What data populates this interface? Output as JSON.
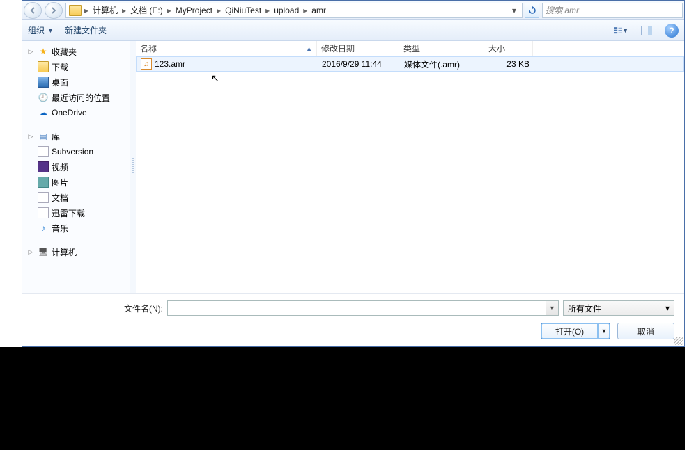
{
  "breadcrumb": {
    "items": [
      "计算机",
      "文档 (E:)",
      "MyProject",
      "QiNiuTest",
      "upload",
      "amr"
    ]
  },
  "search": {
    "placeholder": "搜索 amr"
  },
  "toolbar": {
    "organize": "组织",
    "newfolder": "新建文件夹"
  },
  "sidebar": {
    "favorites": "收藏夹",
    "downloads": "下载",
    "desktop": "桌面",
    "recent": "最近访问的位置",
    "onedrive": "OneDrive",
    "library": "库",
    "subversion": "Subversion",
    "video": "视频",
    "pictures": "图片",
    "documents": "文档",
    "xunlei": "迅雷下载",
    "music": "音乐",
    "computer": "计算机"
  },
  "columns": {
    "name": "名称",
    "modified": "修改日期",
    "type": "类型",
    "size": "大小"
  },
  "files": [
    {
      "name": "123.amr",
      "modified": "2016/9/29 11:44",
      "type": "媒体文件(.amr)",
      "size": "23 KB"
    }
  ],
  "footer": {
    "filename_label": "文件名(N):",
    "filter": "所有文件",
    "open": "打开(O)",
    "cancel": "取消"
  }
}
